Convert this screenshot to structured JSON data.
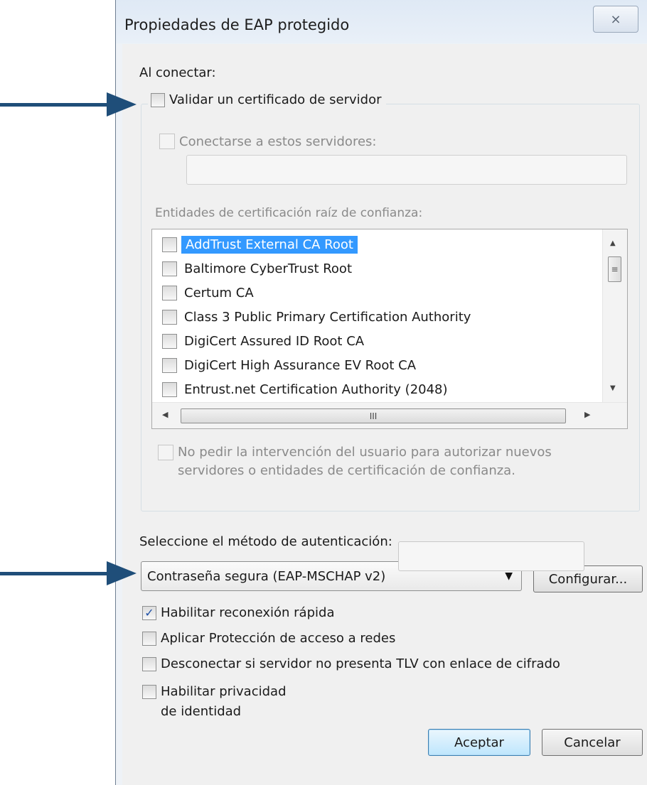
{
  "window": {
    "title": "Propiedades de EAP protegido",
    "close_glyph": "⨯"
  },
  "on_connect_label": "Al conectar:",
  "validate_server_cert": {
    "label": "Validar un certificado de servidor",
    "checked": false
  },
  "connect_to_servers": {
    "label": "Conectarse a estos servidores:",
    "checked": false,
    "enabled": false,
    "value": ""
  },
  "trusted_roots": {
    "label": "Entidades de certificación raíz de confianza:",
    "items": [
      {
        "label": "AddTrust External CA Root",
        "checked": false,
        "selected": true
      },
      {
        "label": "Baltimore CyberTrust Root",
        "checked": false,
        "selected": false
      },
      {
        "label": "Certum CA",
        "checked": false,
        "selected": false
      },
      {
        "label": "Class 3 Public Primary Certification Authority",
        "checked": false,
        "selected": false
      },
      {
        "label": "DigiCert Assured ID Root CA",
        "checked": false,
        "selected": false
      },
      {
        "label": "DigiCert High Assurance EV Root CA",
        "checked": false,
        "selected": false
      },
      {
        "label": "Entrust.net Certification Authority (2048)",
        "checked": false,
        "selected": false
      }
    ],
    "hscroll_grip": "III",
    "vscroll_grip": "≡"
  },
  "no_prompt": {
    "line1": "No pedir la intervención del usuario para autorizar nuevos",
    "line2": "servidores o entidades de certificación de confianza.",
    "checked": false,
    "enabled": false
  },
  "auth_method": {
    "label": "Seleccione el método de autenticación:",
    "selected": "Contraseña segura (EAP-MSCHAP v2)",
    "configure_label": "Configurar..."
  },
  "options": {
    "fast_reconnect": {
      "label": "Habilitar reconexión rápida",
      "checked": true
    },
    "nap": {
      "label": "Aplicar Protección de acceso a redes",
      "checked": false
    },
    "tlv": {
      "label": "Desconectar si servidor no presenta TLV con enlace de cifrado",
      "checked": false
    },
    "identity_privacy": {
      "line1": "Habilitar privacidad",
      "line2": "de identidad",
      "checked": false,
      "value": ""
    }
  },
  "buttons": {
    "ok": "Aceptar",
    "cancel": "Cancelar"
  },
  "annotation": {
    "arrow_color": "#1f4e79"
  }
}
